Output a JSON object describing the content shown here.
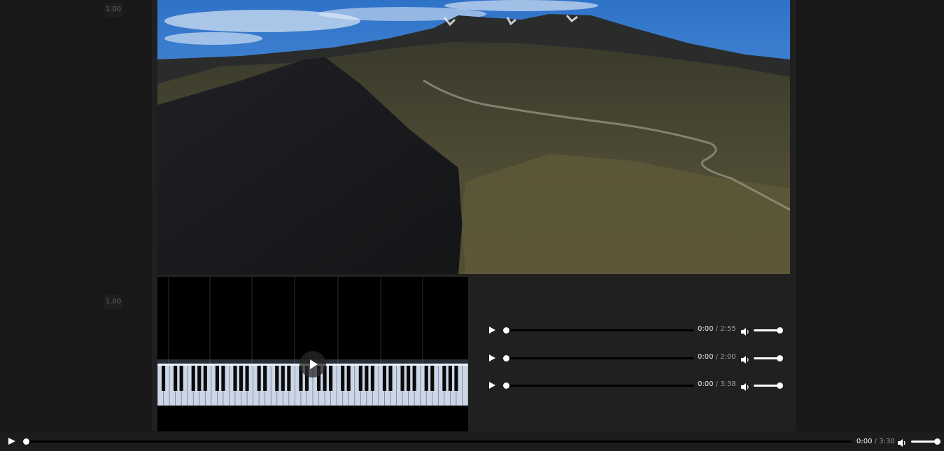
{
  "rates": [
    "1.00",
    "1.00"
  ],
  "audio_players": [
    {
      "current": "0:00",
      "duration": "2:55",
      "progress": 0,
      "volume": 1.0
    },
    {
      "current": "0:00",
      "duration": "2:00",
      "progress": 0,
      "volume": 1.0
    },
    {
      "current": "0:00",
      "duration": "3:38",
      "progress": 0,
      "volume": 1.0
    }
  ],
  "main_player": {
    "current": "0:00",
    "duration": "3:30",
    "progress": 0,
    "volume": 1.0,
    "separator": "/"
  },
  "icons": {
    "play": "play-icon",
    "volume": "volume-icon",
    "fullscreen": "fullscreen-icon"
  },
  "colors": {
    "background": "#181818",
    "panel": "#202020",
    "bar": "#1c1c1c",
    "accent": "#ffffff"
  }
}
